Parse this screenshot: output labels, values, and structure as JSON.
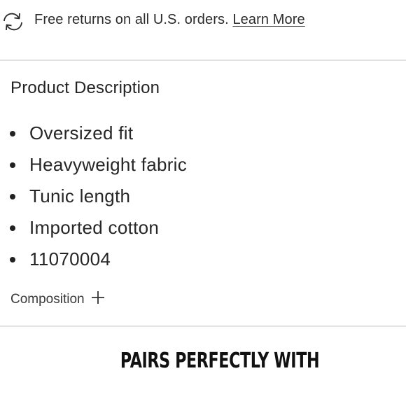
{
  "returns_bar": {
    "icon": "refresh-arrows-icon",
    "text": "Free returns on all U.S. orders.",
    "link_label": "Learn More"
  },
  "product_description": {
    "title": "Product Description",
    "bullets": [
      "Oversized fit",
      "Heavyweight fabric",
      "Tunic length",
      "Imported cotton",
      "11070004"
    ]
  },
  "composition": {
    "label": "Composition",
    "icon": "plus-icon"
  },
  "pairs": {
    "heading": "PAIRS PERFECTLY WITH"
  },
  "colors": {
    "text": "#262626",
    "divider": "#e2e2e2",
    "background": "#ffffff"
  }
}
